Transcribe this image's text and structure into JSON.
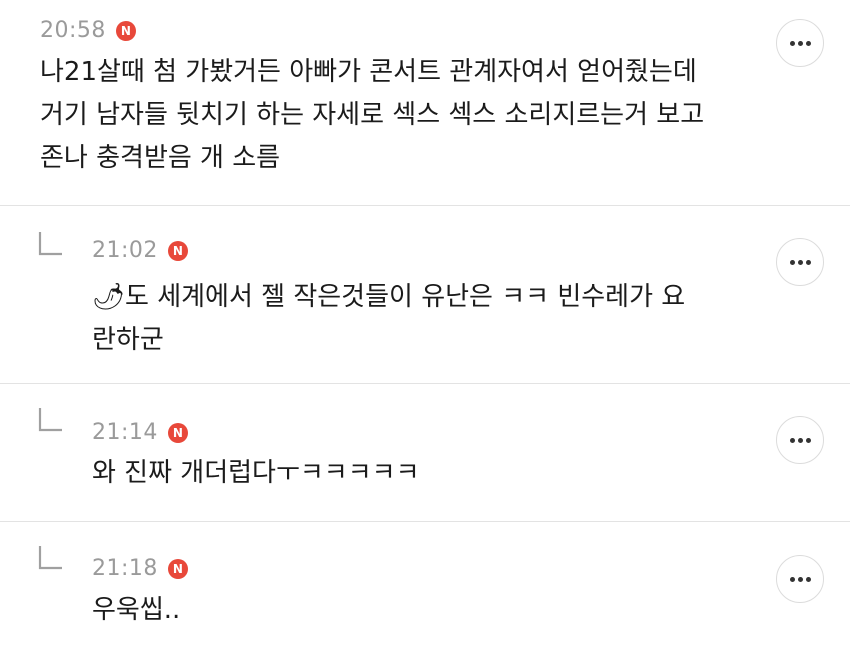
{
  "comments": [
    {
      "time": "20:58",
      "badge": "N",
      "text": "나21살때 첨 가봤거든 아빠가 콘서트 관계자여서 얻어줬는데\n거기 남자들 뒷치기 하는 자세로 섹스 섹스 소리지르는거 보고\n존나 충격받음 개 소름",
      "is_reply": false
    },
    {
      "time": "21:02",
      "badge": "N",
      "emoji": "🌶",
      "text": "도 세계에서 젤 작은것들이 유난은 ㅋㅋ 빈수레가 요\n란하군",
      "is_reply": true
    },
    {
      "time": "21:14",
      "badge": "N",
      "text": "와 진짜 개더럽다ㅜㅋㅋㅋㅋㅋ",
      "is_reply": true
    },
    {
      "time": "21:18",
      "badge": "N",
      "text": "우욱씹..",
      "is_reply": true
    }
  ],
  "colors": {
    "badge": "#e8483a",
    "time": "#9a9a9a",
    "divider": "#e3e3e3"
  },
  "icons": {
    "more": "more-icon",
    "reply": "reply-arrow-icon"
  }
}
